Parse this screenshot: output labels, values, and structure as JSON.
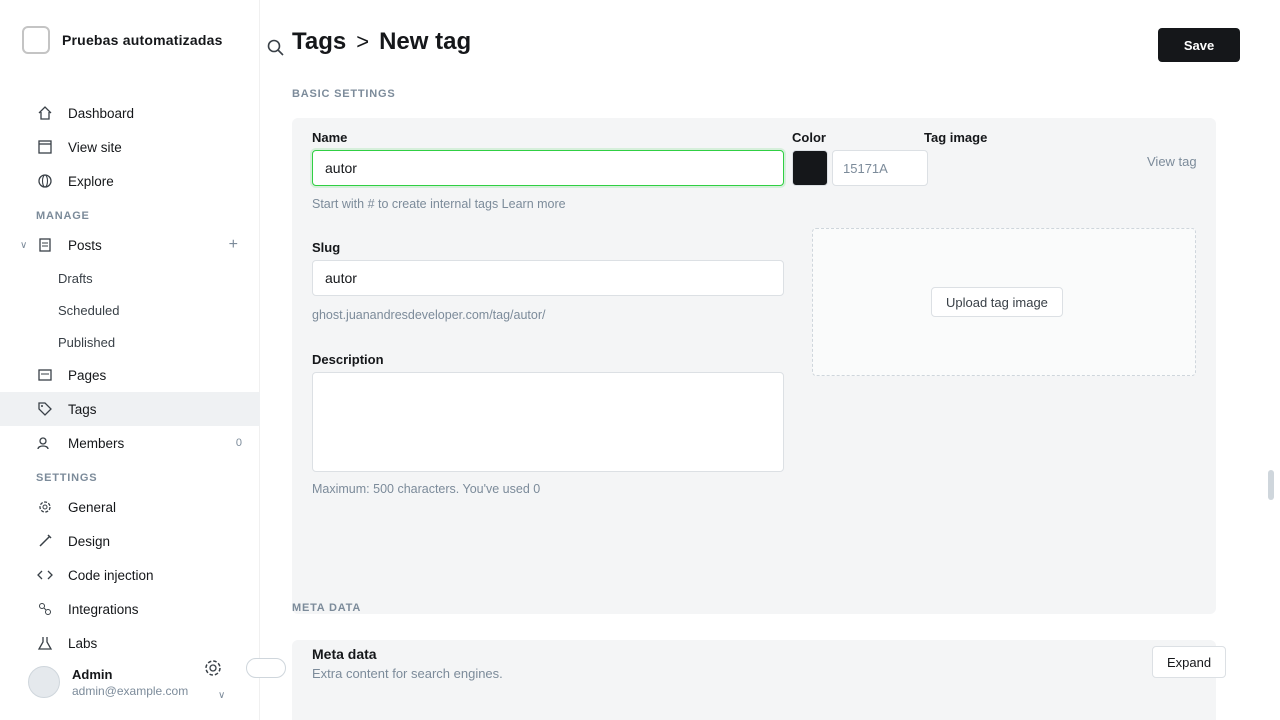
{
  "app": {
    "site_name": "Pruebas automatizadas"
  },
  "sidebar": {
    "nav": [
      {
        "label": "Dashboard"
      },
      {
        "label": "View site"
      },
      {
        "label": "Explore"
      }
    ],
    "manage_heading": "MANAGE",
    "posts": {
      "label": "Posts",
      "children": [
        {
          "label": "Drafts"
        },
        {
          "label": "Scheduled"
        },
        {
          "label": "Published"
        }
      ]
    },
    "manage_items": [
      {
        "label": "Pages"
      },
      {
        "label": "Tags"
      },
      {
        "label": "Members",
        "badge": "0"
      }
    ],
    "settings_heading": "SETTINGS",
    "settings_items": [
      {
        "label": "General"
      },
      {
        "label": "Design"
      },
      {
        "label": "Code injection"
      },
      {
        "label": "Integrations"
      },
      {
        "label": "Labs"
      }
    ],
    "user": {
      "name": "Admin",
      "email": "admin@example.com"
    }
  },
  "header": {
    "breadcrumb_parent": "Tags",
    "breadcrumb_sep": ">",
    "breadcrumb_current": "New tag",
    "page_title": "New tag",
    "save_label": "Save"
  },
  "basic_settings": {
    "section_label": "BASIC SETTINGS",
    "name_label": "Name",
    "name_value": "autor",
    "name_hint": "Start with # to create internal tags Learn more",
    "color_label": "Color",
    "color_value": "15171A",
    "image_label": "Tag image",
    "upload_label": "Upload tag image",
    "view_tag_label": "View tag",
    "slug_label": "Slug",
    "slug_value": "autor",
    "slug_url": "ghost.juanandresdeveloper.com/tag/autor/",
    "description_label": "Description",
    "description_hint": "Maximum: 500 characters. You've used 0"
  },
  "meta_data": {
    "section_label": "META DATA",
    "title": "Meta data",
    "description": "Extra content for search engines.",
    "expand_label": "Expand"
  }
}
